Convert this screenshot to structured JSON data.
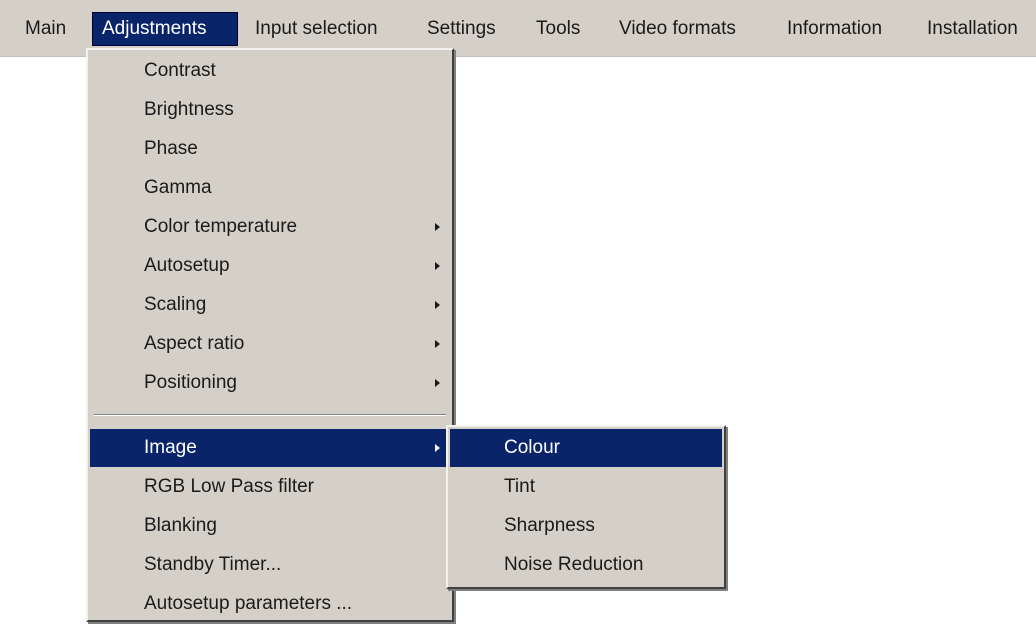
{
  "menubar": {
    "items": [
      {
        "label": "Main"
      },
      {
        "label": "Adjustments"
      },
      {
        "label": "Input selection"
      },
      {
        "label": "Settings"
      },
      {
        "label": "Tools"
      },
      {
        "label": "Video formats"
      },
      {
        "label": "Information"
      },
      {
        "label": "Installation"
      }
    ]
  },
  "adjustments_menu": {
    "items": [
      {
        "label": "Contrast"
      },
      {
        "label": "Brightness"
      },
      {
        "label": "Phase"
      },
      {
        "label": "Gamma"
      },
      {
        "label": "Color temperature"
      },
      {
        "label": "Autosetup"
      },
      {
        "label": "Scaling"
      },
      {
        "label": "Aspect ratio"
      },
      {
        "label": "Positioning"
      },
      {
        "label": "Image"
      },
      {
        "label": "RGB Low Pass filter"
      },
      {
        "label": "Blanking"
      },
      {
        "label": "Standby Timer..."
      },
      {
        "label": "Autosetup parameters ..."
      }
    ]
  },
  "image_submenu": {
    "items": [
      {
        "label": "Colour"
      },
      {
        "label": "Tint"
      },
      {
        "label": "Sharpness"
      },
      {
        "label": "Noise Reduction"
      }
    ]
  },
  "colors": {
    "menu_bg": "#d4d0c8",
    "highlight": "#0a246a",
    "highlight_text": "#ffffff"
  },
  "icons": {
    "submenu_arrow": "submenu-arrow-icon"
  }
}
